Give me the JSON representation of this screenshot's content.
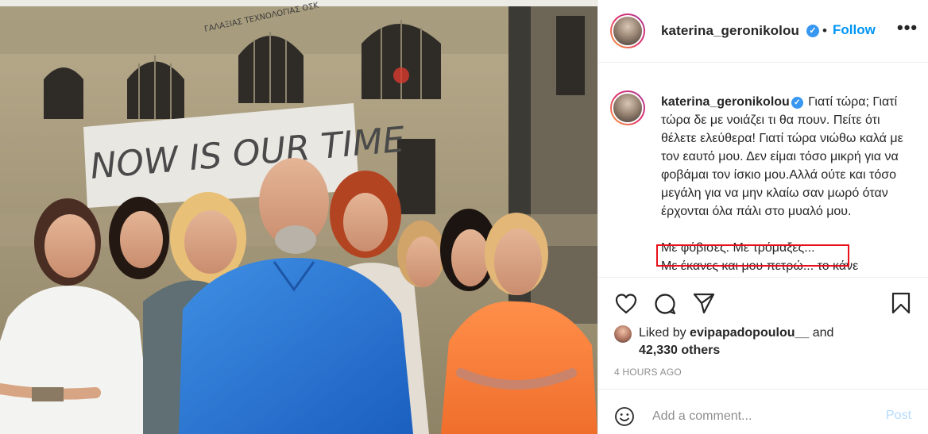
{
  "photo": {
    "wall_graffiti": "NOW IS OUR TIME",
    "shop_sign": "ΓΑΛΑΞΙΑΣ ΤΕΧΝΟΛΟΓΙΑΣ ΟΣΚ"
  },
  "header": {
    "username": "katerina_geronikolou",
    "separator": "•",
    "follow_label": "Follow",
    "more_label": "•••"
  },
  "caption": {
    "username": "katerina_geronikolou",
    "paragraph1": "Γιατί τώρα; Γιατί τώρα δε με νοιάζει τι θα πουν. Πείτε ότι θέλετε ελεύθερα! Γιατί τώρα νιώθω καλά με τον εαυτό μου. Δεν είμαι τόσο μικρή για να φοβάμαι τον ίσκιο μου.Αλλά ούτε και τόσο μεγάλη για να μην κλαίω σαν μωρό όταν έρχονται όλα πάλι στο μυαλό μου.",
    "paragraph2": "Με φόβισες. Με τρόμαξες...",
    "paragraph3": "Με έκανες και μου πετρώ... το κάνε"
  },
  "actions": {
    "like_icon": "heart-icon",
    "comment_icon": "comment-icon",
    "share_icon": "paper-plane-icon",
    "save_icon": "bookmark-icon"
  },
  "likes": {
    "prefix": "Liked by ",
    "user": "evipapadopoulou__",
    "and": " and",
    "others": "42,330 others"
  },
  "timestamp": "4 HOURS AGO",
  "comment": {
    "placeholder": "Add a comment...",
    "post_label": "Post"
  },
  "colors": {
    "accent": "#0095f6",
    "post_disabled": "#b3dbff",
    "verified": "#3897f0",
    "highlight": "#e8101a",
    "secondary_text": "#8e8e8e"
  }
}
